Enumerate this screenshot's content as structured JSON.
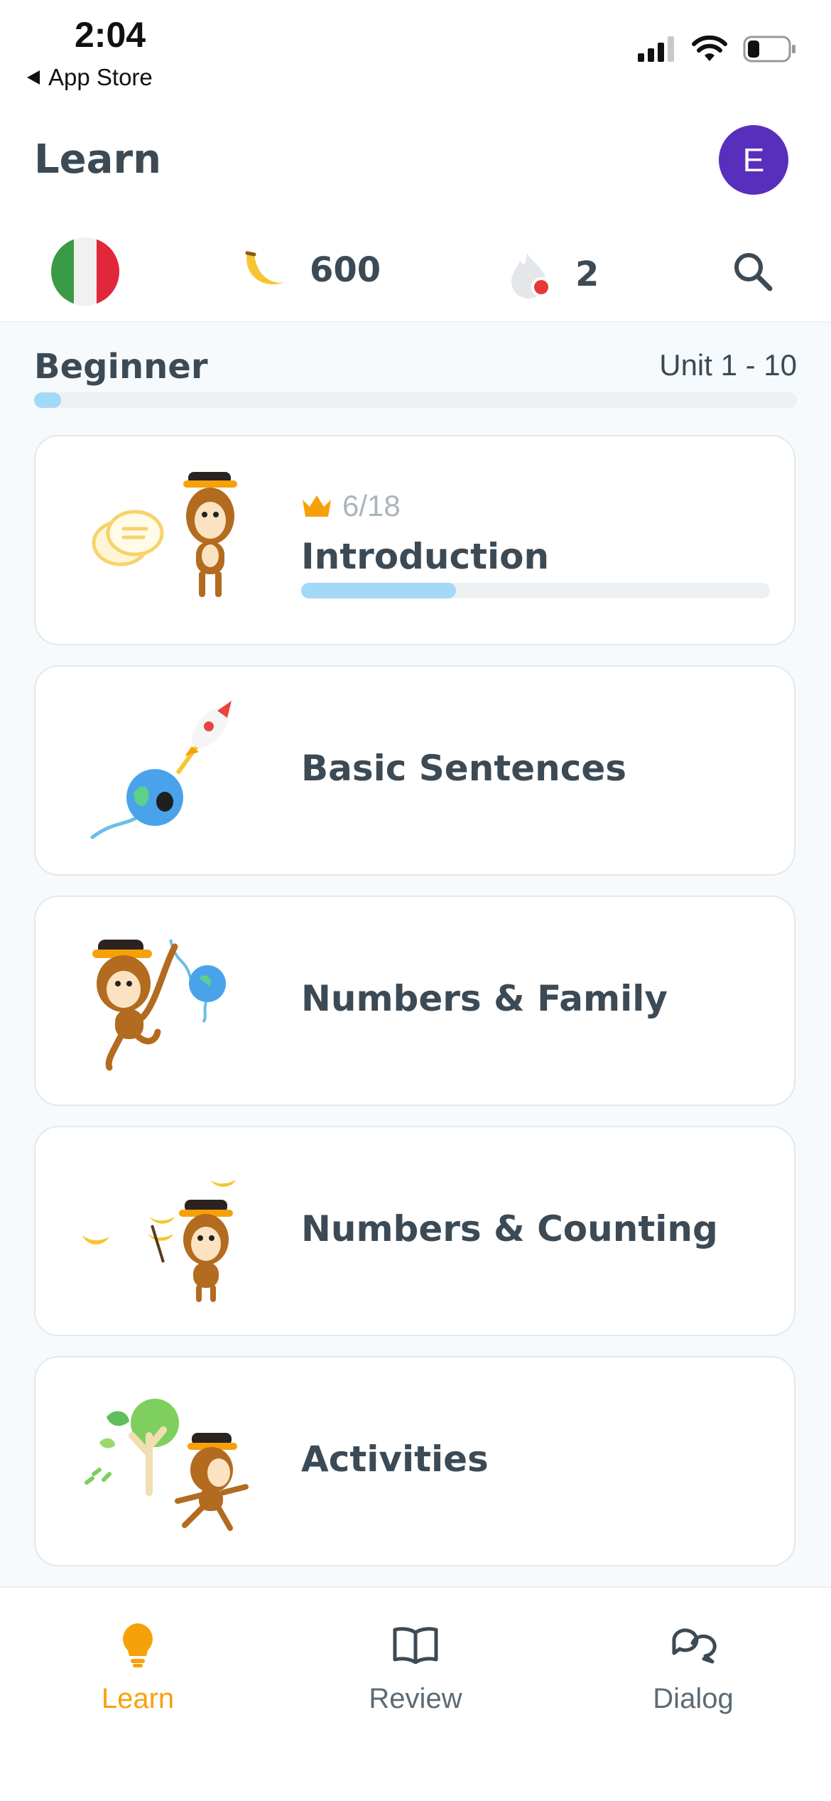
{
  "status_bar": {
    "time": "2:04",
    "back_label": "App Store"
  },
  "header": {
    "title": "Learn",
    "avatar_initial": "E"
  },
  "stats": {
    "flag": "italy-flag",
    "bananas": "600",
    "streak": "2"
  },
  "course": {
    "level": "Beginner",
    "range": "Unit 1 - 10",
    "level_progress": 0.03
  },
  "units": [
    {
      "title": "Introduction",
      "crowns": "6/18",
      "progress": 0.33,
      "art": "monkey-speech-bubble"
    },
    {
      "title": "Basic Sentences",
      "art": "globe-rocket"
    },
    {
      "title": "Numbers & Family",
      "art": "monkey-globe-balloon"
    },
    {
      "title": "Numbers & Counting",
      "art": "monkey-bananas"
    },
    {
      "title": "Activities",
      "art": "monkey-tree-running"
    }
  ],
  "tabs": [
    {
      "label": "Learn",
      "icon": "lightbulb-icon",
      "active": true
    },
    {
      "label": "Review",
      "icon": "book-icon",
      "active": false
    },
    {
      "label": "Dialog",
      "icon": "chat-bubbles-icon",
      "active": false
    }
  ],
  "colors": {
    "accent": "#f7a10a",
    "avatar": "#5a2ebd",
    "progress": "#a3d9f8",
    "text": "#3c4a55"
  }
}
